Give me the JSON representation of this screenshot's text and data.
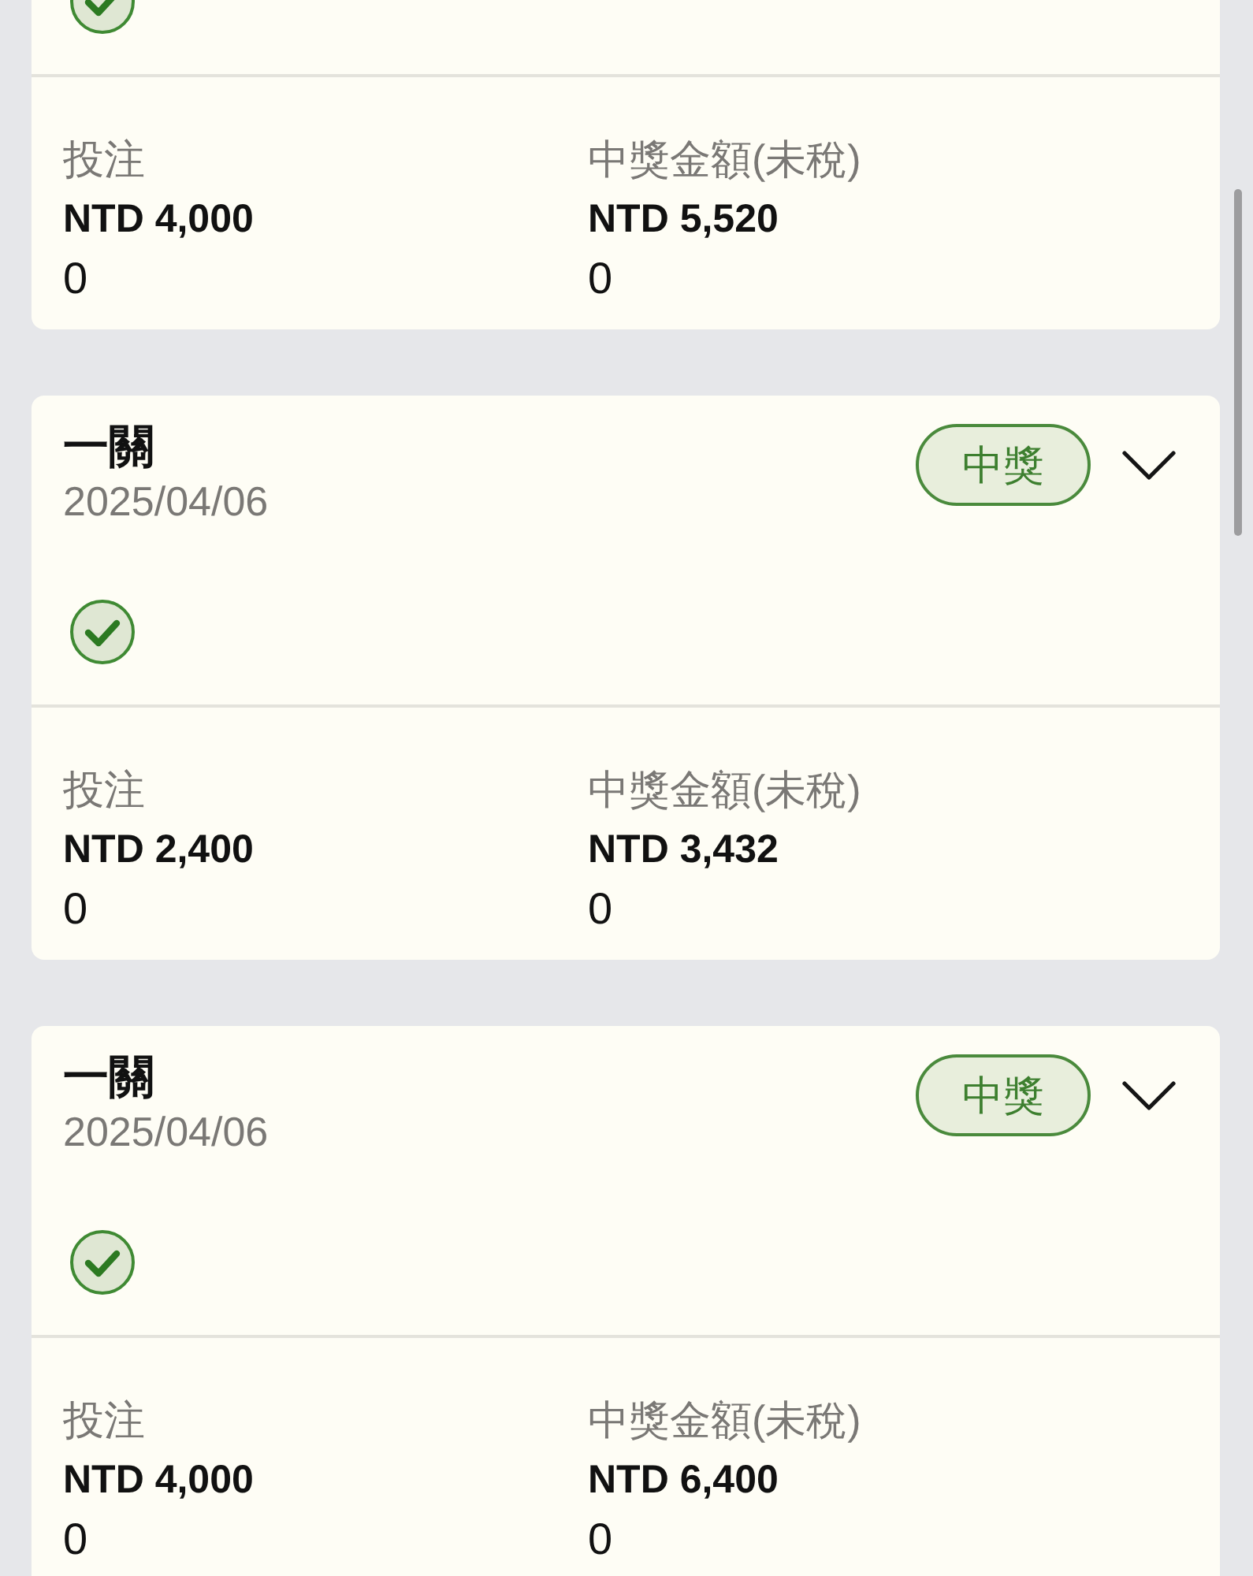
{
  "bets": [
    {
      "stats": [
        {
          "label": "投注",
          "amount": "NTD 4,000",
          "value": "0"
        },
        {
          "label": "中獎金額(未稅)",
          "amount": "NTD 5,520",
          "value": "0"
        }
      ]
    },
    {
      "title": "一關",
      "date": "2025/04/06",
      "badge": "中獎",
      "expanded": false,
      "stats": [
        {
          "label": "投注",
          "amount": "NTD 2,400",
          "value": "0"
        },
        {
          "label": "中獎金額(未稅)",
          "amount": "NTD 3,432",
          "value": "0"
        }
      ]
    },
    {
      "title": "一關",
      "date": "2025/04/06",
      "badge": "中獎",
      "expanded": false,
      "stats": [
        {
          "label": "投注",
          "amount": "NTD 4,000",
          "value": "0"
        },
        {
          "label": "中獎金額(未稅)",
          "amount": "NTD 6,400",
          "value": "0"
        }
      ]
    }
  ]
}
